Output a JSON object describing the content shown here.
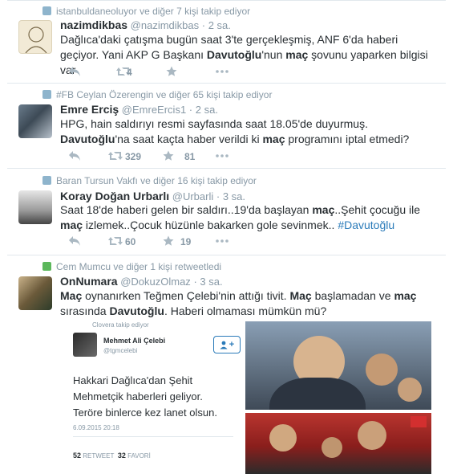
{
  "tweets": [
    {
      "context": "istanbuldaneoluyor ve diğer 7 kişi takip ediyor",
      "fullname": "nazimdikbas",
      "handle": "@nazimdikbas",
      "dot": "·",
      "time": "2 sa.",
      "text_parts": [
        "Dağlıca'daki çatışma bugün saat 3'te gerçekleşmiş, ANF 6'da haberi geçiyor. Yani AKP G Başkanı ",
        "Davutoğlu",
        "'nun ",
        "maç",
        " şovunu yaparken bilgisi var"
      ],
      "retweets": "4",
      "favorites": ""
    },
    {
      "context": "#FB Ceylan Özerengin ve diğer 65 kişi takip ediyor",
      "fullname": "Emre Erciş",
      "handle": "@EmreErcis1",
      "dot": "·",
      "time": "2 sa.",
      "text_parts": [
        "HPG, hain saldırıyı resmi sayfasında saat 18.05'de duyurmuş. ",
        "Davutoğlu",
        "'na saat kaçta haber verildi ki ",
        "maç",
        " programını iptal etmedi?"
      ],
      "retweets": "329",
      "favorites": "81"
    },
    {
      "context": "Baran Tursun Vakfı ve diğer 16 kişi takip ediyor",
      "fullname": "Koray Doğan Urbarlı",
      "handle": "@Urbarli",
      "dot": "·",
      "time": "3 sa.",
      "text_parts": [
        "Saat 18'de haberi gelen bir saldırı..19'da başlayan ",
        "maç",
        "..Şehit çocuğu ile ",
        "maç",
        " izlemek..Çocuk hüzünle bakarken gole sevinmek.. ",
        "#Davutoğlu"
      ],
      "retweets": "60",
      "favorites": "19"
    },
    {
      "context": "Cem Mumcu ve diğer 1 kişi retweetledi",
      "fullname": "OnNumara",
      "handle": "@DokuzOlmaz",
      "dot": "·",
      "time": "3 sa.",
      "text_parts": [
        "Maç",
        " oynanırken Teğmen Çelebi'nin attığı tivit. ",
        "Maç",
        " başlamadan ve ",
        "maç",
        " sırasında ",
        "Davutoğlu",
        ". Haberi olmaması mümkün mü?"
      ]
    }
  ],
  "embedded": {
    "context": "Clovera takip ediyor",
    "name": "Mehmet Ali Çelebi",
    "handle": "@tgmcelebi",
    "follow_icon": "+",
    "text": "Hakkari Dağlıca'dan Şehit Mehmetçik haberleri geliyor. Teröre binlerce kez lanet olsun.",
    "date": "6.09.2015 20:18",
    "retweets": "52",
    "retweet_label": "RETWEET",
    "favorites": "32",
    "favorite_label": "FAVORİ"
  },
  "icons": {
    "follow_context": "person-follow-icon",
    "retweet_context": "retweet-icon",
    "reply": "reply-icon",
    "retweet": "retweet-icon",
    "favorite": "star-icon",
    "more": "more-dots-icon"
  },
  "colors": {
    "text": "#292f33",
    "muted": "#8899a6",
    "link": "#2b7bb9",
    "border": "#e1e8ed",
    "retweet_green": "#5cb85c"
  }
}
